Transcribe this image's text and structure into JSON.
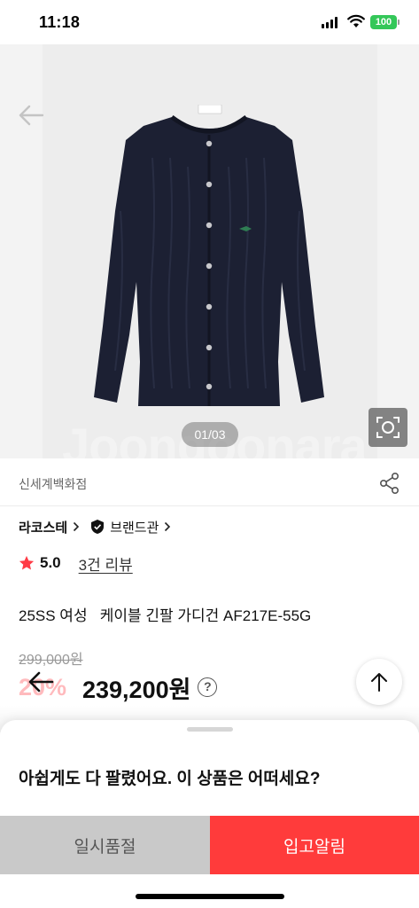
{
  "status_bar": {
    "time": "11:18",
    "battery": "100",
    "battery_color": "#34c759"
  },
  "gallery": {
    "page_indicator": "01/03",
    "watermark": "Joongoonara",
    "icons": {
      "back": "back-arrow-icon",
      "zoom": "camera-frame-icon"
    }
  },
  "seller": {
    "name": "신세계백화점",
    "share_icon": "share-icon"
  },
  "brand": {
    "name": "라코스테",
    "hall_label": "브랜드관"
  },
  "rating": {
    "value": "5.0",
    "reviews": "3건 리뷰",
    "star_color": "#ff3b45"
  },
  "product": {
    "title": "25SS 여성   케이블 긴팔 가디건 AF217E-55G",
    "original_price": "299,000원",
    "discount": "20%",
    "sale_price": "239,200원",
    "info_icon_label": "?"
  },
  "sheet": {
    "title": "아쉽게도 다 팔렸어요. 이 상품은 어떠세요?",
    "soldout_label": "일시품절",
    "notify_label": "입고알림",
    "notify_color": "#ff3b3b"
  }
}
